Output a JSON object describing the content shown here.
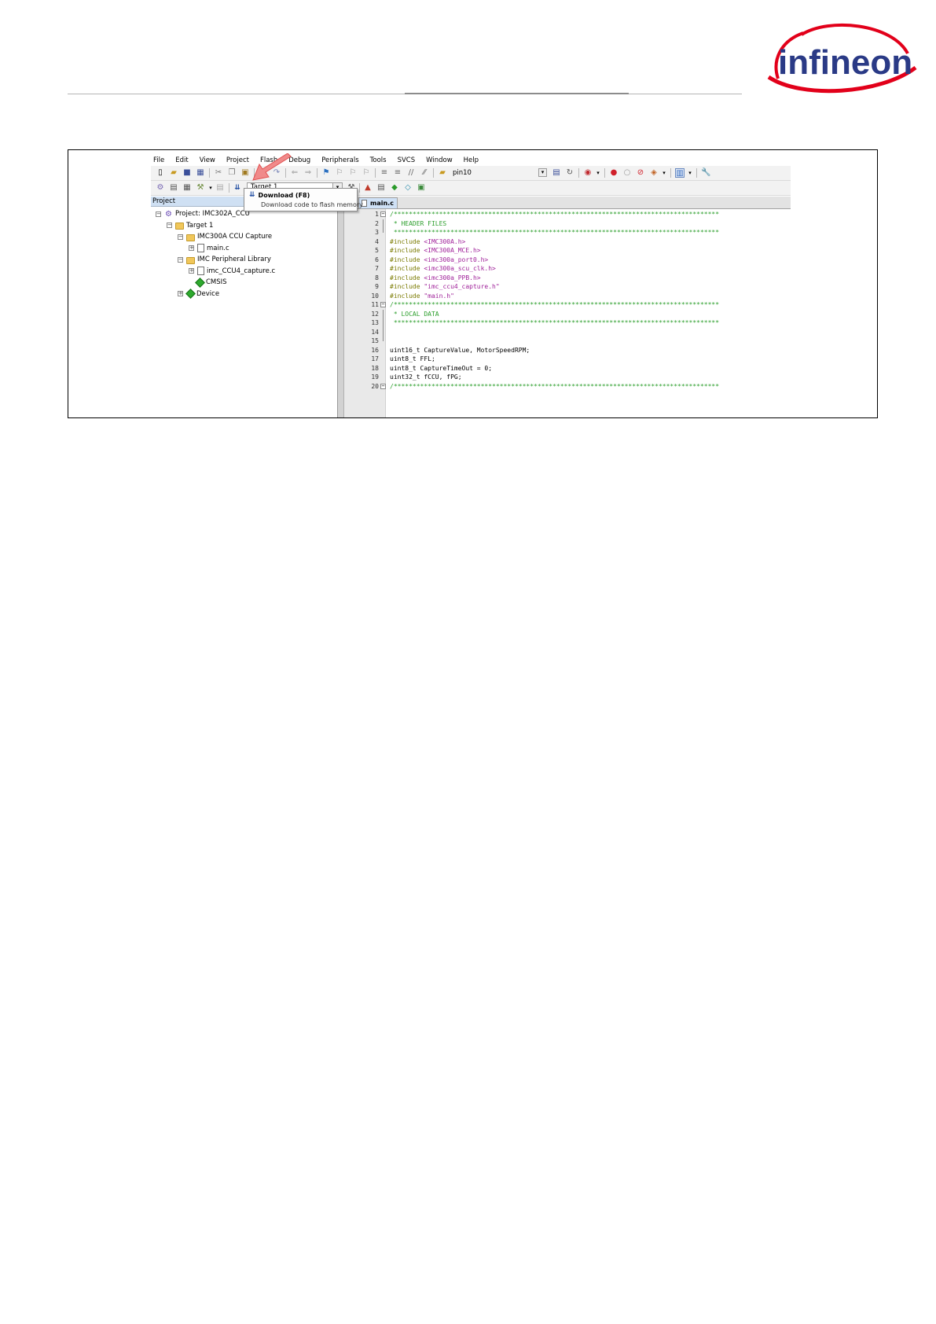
{
  "brand": {
    "logo_text": "infineon",
    "logo_color": "#2a3a86",
    "swoosh_color": "#e2001a"
  },
  "ide": {
    "menu": [
      "File",
      "Edit",
      "View",
      "Project",
      "Flash",
      "Debug",
      "Peripherals",
      "Tools",
      "SVCS",
      "Window",
      "Help"
    ],
    "toolbar1": {
      "find_combo_value": "pin10"
    },
    "toolbar2": {
      "target_select_value": "Target 1"
    },
    "dropdown": {
      "title": "Download (F8)",
      "description": "Download code to flash memory"
    },
    "project_pane": {
      "header": "Project",
      "tree": [
        {
          "label": "Project: IMC302A_CCU",
          "icon": "project-icon",
          "expander": "−"
        },
        {
          "label": "Target 1",
          "icon": "folder-icon",
          "expander": "−"
        },
        {
          "label": "IMC300A CCU Capture",
          "icon": "folder-icon",
          "expander": "−"
        },
        {
          "label": "main.c",
          "icon": "file-icon",
          "expander": "+"
        },
        {
          "label": "IMC Peripheral Library",
          "icon": "folder-icon",
          "expander": "−"
        },
        {
          "label": "imc_CCU4_capture.c",
          "icon": "file-icon",
          "expander": "+"
        },
        {
          "label": "CMSIS",
          "icon": "gem-icon",
          "expander": ""
        },
        {
          "label": "Device",
          "icon": "gem-icon",
          "expander": "+"
        }
      ]
    },
    "editor": {
      "tab_label": "main.c",
      "lines": [
        {
          "n": "1",
          "text": "/**************************************************************************************",
          "kind": "comment",
          "fold": "−"
        },
        {
          "n": "2",
          "text": " * HEADER FILES",
          "kind": "comment",
          "fold": ""
        },
        {
          "n": "3",
          "text": " **************************************************************************************",
          "kind": "comment",
          "fold": "end"
        },
        {
          "n": "4",
          "pre": "#include ",
          "str": "<IMC300A.h>",
          "kind": "include"
        },
        {
          "n": "5",
          "pre": "#include ",
          "str": "<IMC300A_MCE.h>",
          "kind": "include"
        },
        {
          "n": "6",
          "pre": "#include ",
          "str": "<imc300a_port0.h>",
          "kind": "include"
        },
        {
          "n": "7",
          "pre": "#include ",
          "str": "<imc300a_scu_clk.h>",
          "kind": "include"
        },
        {
          "n": "8",
          "pre": "#include ",
          "str": "<imc300a_PPB.h>",
          "kind": "include"
        },
        {
          "n": "9",
          "pre": "#include ",
          "str": "\"imc_ccu4_capture.h\"",
          "kind": "include"
        },
        {
          "n": "10",
          "pre": "#include ",
          "str": "\"main.h\"",
          "kind": "include"
        },
        {
          "n": "11",
          "text": "/**************************************************************************************",
          "kind": "comment",
          "fold": "−"
        },
        {
          "n": "12",
          "text": " * LOCAL DATA",
          "kind": "comment",
          "fold": ""
        },
        {
          "n": "13",
          "text": " **************************************************************************************",
          "kind": "comment",
          "fold": ""
        },
        {
          "n": "14",
          "text": "",
          "kind": "plain",
          "fold": ""
        },
        {
          "n": "15",
          "text": "",
          "kind": "plain",
          "fold": "end"
        },
        {
          "n": "16",
          "text": "uint16_t CaptureValue, MotorSpeedRPM;",
          "kind": "plain"
        },
        {
          "n": "17",
          "text": "uint8_t FFL;",
          "kind": "plain"
        },
        {
          "n": "18",
          "text": "uint8_t CaptureTimeOut = 0;",
          "kind": "plain"
        },
        {
          "n": "19",
          "text": "uint32_t fCCU, fPG;",
          "kind": "plain"
        },
        {
          "n": "20",
          "text": "/**************************************************************************************",
          "kind": "comment",
          "fold": "−"
        }
      ]
    }
  }
}
